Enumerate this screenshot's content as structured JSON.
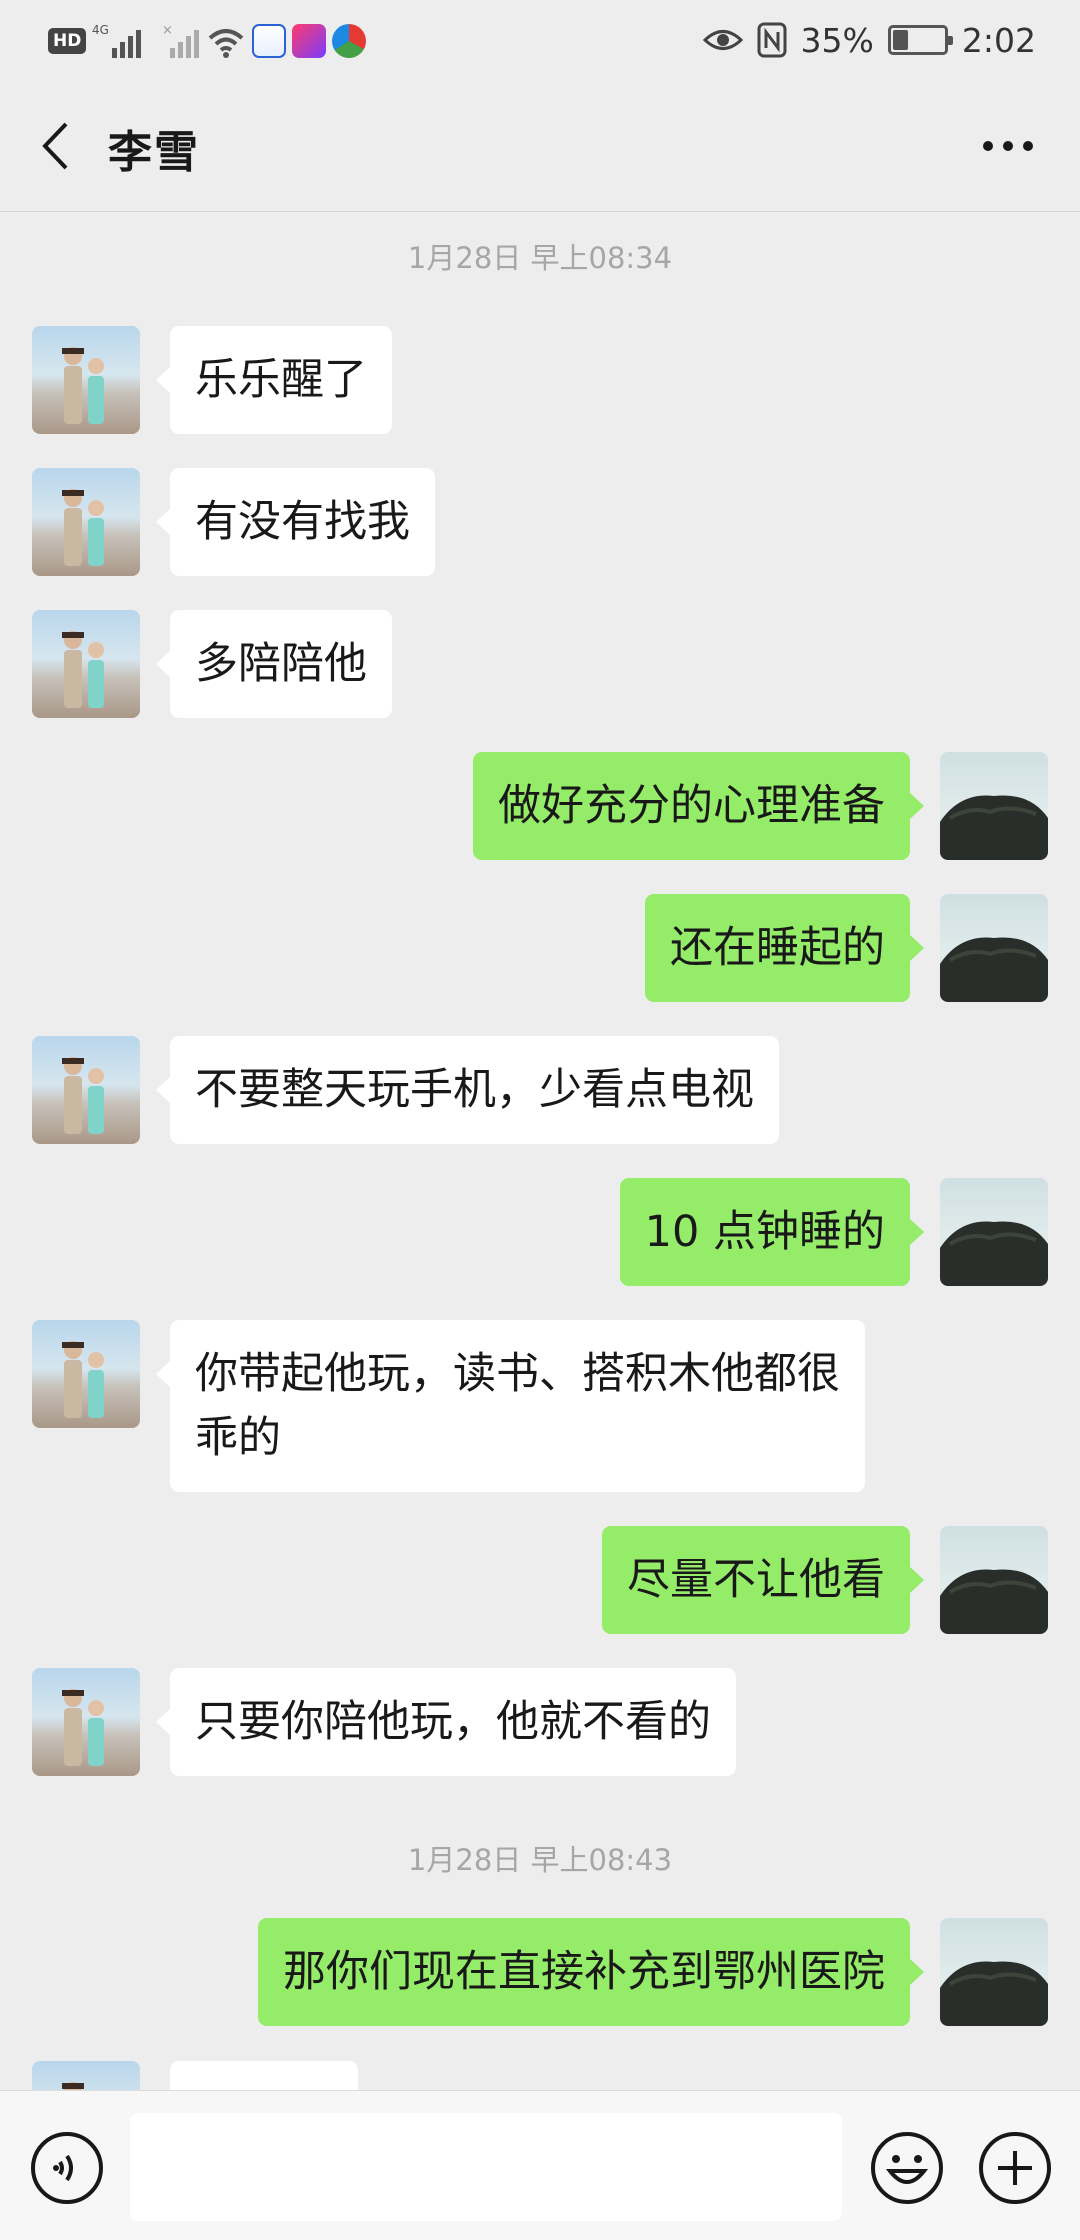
{
  "status_bar": {
    "hd_label": "HD",
    "network_label": "4G",
    "battery_percent_text": "35%",
    "battery_level": 0.35,
    "time": "2:02"
  },
  "header": {
    "title": "李雪"
  },
  "messages": [
    {
      "type": "time",
      "text": "1月28日 早上08:34"
    },
    {
      "type": "message",
      "side": "left",
      "text": "乐乐醒了"
    },
    {
      "type": "message",
      "side": "left",
      "text": "有没有找我"
    },
    {
      "type": "message",
      "side": "left",
      "text": "多陪陪他"
    },
    {
      "type": "message",
      "side": "right",
      "text": "做好充分的心理准备"
    },
    {
      "type": "message",
      "side": "right",
      "text": "还在睡起的"
    },
    {
      "type": "message",
      "side": "left",
      "text": "不要整天玩手机，少看点电视"
    },
    {
      "type": "message",
      "side": "right",
      "text": "10 点钟睡的"
    },
    {
      "type": "message",
      "side": "left",
      "text": "你带起他玩，读书、搭积木他都很\n乖的"
    },
    {
      "type": "message",
      "side": "right",
      "text": "尽量不让他看"
    },
    {
      "type": "message",
      "side": "left",
      "text": "只要你陪他玩，他就不看的"
    },
    {
      "type": "time",
      "text": "1月28日 早上08:43"
    },
    {
      "type": "message",
      "side": "right",
      "text": "那你们现在直接补充到鄂州医院"
    },
    {
      "type": "message",
      "side": "left",
      "text": ""
    }
  ],
  "colors": {
    "background": "#ededed",
    "sent_bubble": "#95ec69",
    "received_bubble": "#ffffff",
    "timestamp": "#a6a6a6"
  },
  "icons": {
    "back": "chevron-left-icon",
    "more": "more-horizontal-icon",
    "voice": "voice-icon",
    "emoji": "emoji-icon",
    "plus": "plus-icon"
  },
  "input": {
    "value": ""
  }
}
